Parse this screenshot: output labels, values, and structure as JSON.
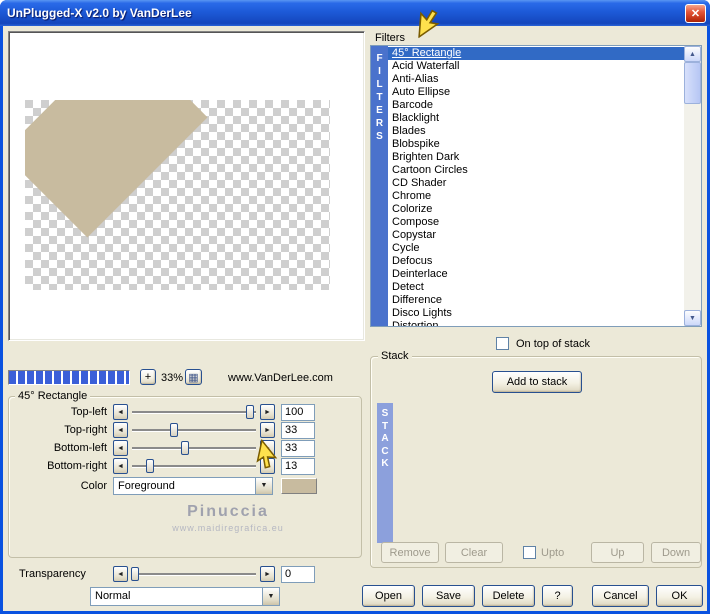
{
  "window": {
    "title": "UnPlugged-X v2.0 by VanDerLee"
  },
  "icons": {
    "close": "✕",
    "left_arrow": "◄",
    "right_arrow": "►",
    "up_arrow": "▲",
    "down_arrow": "▼",
    "keypad": "▦",
    "plus": "+"
  },
  "preview": {
    "zoom_level": "33%",
    "vendor": "www.VanDerLee.com",
    "shape_color": "#c8bb9f"
  },
  "params": {
    "group_title": "45° Rectangle",
    "sliders": [
      {
        "label": "Top-left",
        "value": "100",
        "pct": 94
      },
      {
        "label": "Top-right",
        "value": "33",
        "pct": 34
      },
      {
        "label": "Bottom-left",
        "value": "33",
        "pct": 43
      },
      {
        "label": "Bottom-right",
        "value": "13",
        "pct": 16
      }
    ],
    "color_label": "Color",
    "color_value": "Foreground",
    "color_swatch": "#c8bb9f"
  },
  "watermark": {
    "name": "Pinuccia",
    "url": "www.maidiregrafica.eu"
  },
  "transparency": {
    "label": "Transparency",
    "value": "0",
    "pct": 4
  },
  "blend": {
    "value": "Normal"
  },
  "filters": {
    "label": "Filters",
    "vertical_label": "FILTERS",
    "selected_index": 0,
    "on_top_label": "On top of stack",
    "items": [
      "45° Rectangle",
      "Acid Waterfall",
      "Anti-Alias",
      "Auto Ellipse",
      "Barcode",
      "Blacklight",
      "Blades",
      "Blobspike",
      "Brighten Dark",
      "Cartoon Circles",
      "CD Shader",
      "Chrome",
      "Colorize",
      "Compose",
      "Copystar",
      "Cycle",
      "Defocus",
      "Deinterlace",
      "Detect",
      "Difference",
      "Disco Lights",
      "Distortion"
    ]
  },
  "stack": {
    "group_title": "Stack",
    "vertical_label": "STACK",
    "add_label": "Add to stack",
    "remove_label": "Remove",
    "clear_label": "Clear",
    "upto_label": "Upto",
    "up_label": "Up",
    "down_label": "Down"
  },
  "footer": {
    "open": "Open",
    "save": "Save",
    "delete": "Delete",
    "help": "?",
    "cancel": "Cancel",
    "ok": "OK"
  }
}
